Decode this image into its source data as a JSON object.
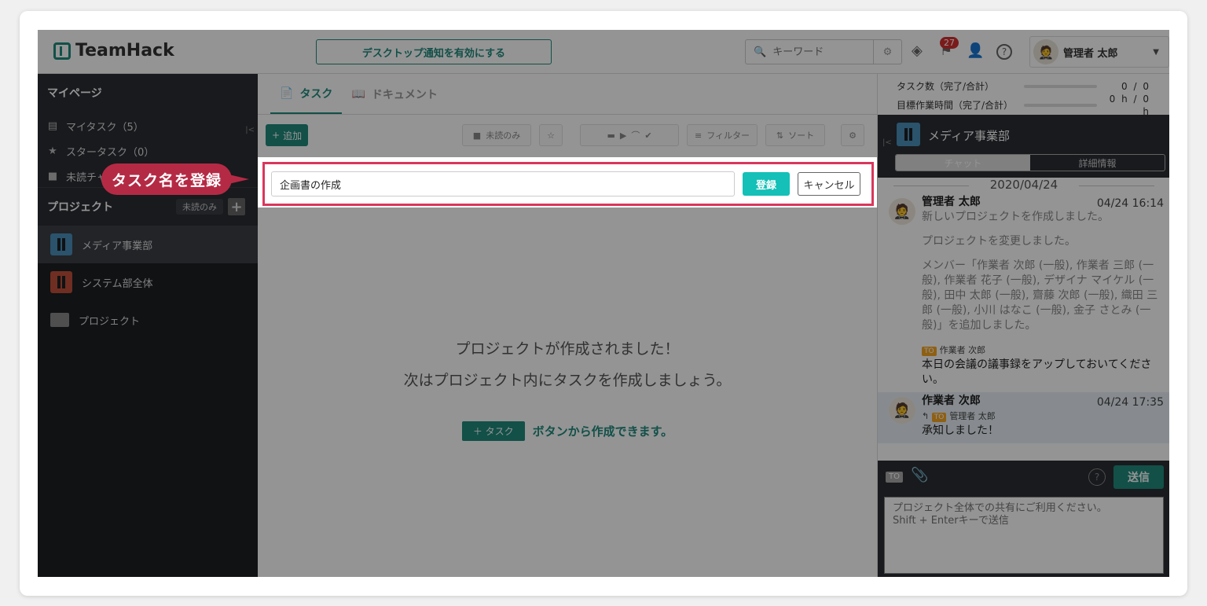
{
  "app": {
    "name": "TeamHack"
  },
  "topbar": {
    "notify_label": "デスクトップ通知を有効にする",
    "search_placeholder": "キーワード",
    "notification_count": "27",
    "user_name": "管理者 太郎"
  },
  "sidebar": {
    "mypage_title": "マイページ",
    "items": [
      {
        "label": "マイタスク（5）",
        "icon": "document-icon"
      },
      {
        "label": "スタータスク（0）",
        "icon": "star-icon"
      },
      {
        "label": "未読チャット",
        "icon": "chat-icon"
      }
    ],
    "project_title": "プロジェクト",
    "unread_only": "未読のみ",
    "projects": [
      {
        "label": "メディア事業部",
        "color": "#4a90b8"
      },
      {
        "label": "システム部全体",
        "color": "#c0503a"
      },
      {
        "label": "プロジェクト",
        "color": "#888888"
      }
    ]
  },
  "main": {
    "tabs": [
      {
        "label": "タスク"
      },
      {
        "label": "ドキュメント"
      }
    ],
    "add_label": "追加",
    "unread_only": "未読のみ",
    "filter_label": "フィルター",
    "sort_label": "ソート",
    "task_input_value": "企画書の作成",
    "register_label": "登録",
    "cancel_label": "キャンセル",
    "empty_line1": "プロジェクトが作成されました！",
    "empty_line2": "次はプロジェクト内にタスクを作成しましょう。",
    "empty_hint_button": "＋ タスク",
    "empty_hint_text": "ボタンから作成できます。"
  },
  "callout": {
    "label": "タスク名を登録"
  },
  "right": {
    "stats": [
      {
        "label": "タスク数（完了/合計）",
        "value": "0 / 0"
      },
      {
        "label": "目標作業時間（完了/合計）",
        "value": "0 h / 0 h"
      }
    ],
    "project_name": "メディア事業部",
    "tab_chat": "チャット",
    "tab_details": "詳細情報",
    "date": "2020/04/24",
    "messages": [
      {
        "author": "管理者 太郎",
        "time": "04/24 16:14",
        "line1": "新しいプロジェクトを作成しました。",
        "line2": "プロジェクトを変更しました。",
        "line3": "メンバー「作業者 次郎 (一般), 作業者 三郎 (一般), 作業者 花子 (一般), デザイナ マイケル (一般), 田中 太郎 (一般), 齋藤 次郎 (一般), 織田 三郎 (一般), 小川 はなこ (一般), 金子 さとみ (一般)」を追加しました。",
        "to_name": "作業者 次郎",
        "to_text": "本日の会議の議事録をアップしておいてください。"
      },
      {
        "author": "作業者 次郎",
        "time": "04/24 17:35",
        "reply_to": "管理者 太郎",
        "text": "承知しました！"
      }
    ],
    "to_badge": "TO",
    "send_label": "送信",
    "compose_placeholder": "プロジェクト全体での共有にご利用ください。\nShift + Enterキーで送信"
  }
}
